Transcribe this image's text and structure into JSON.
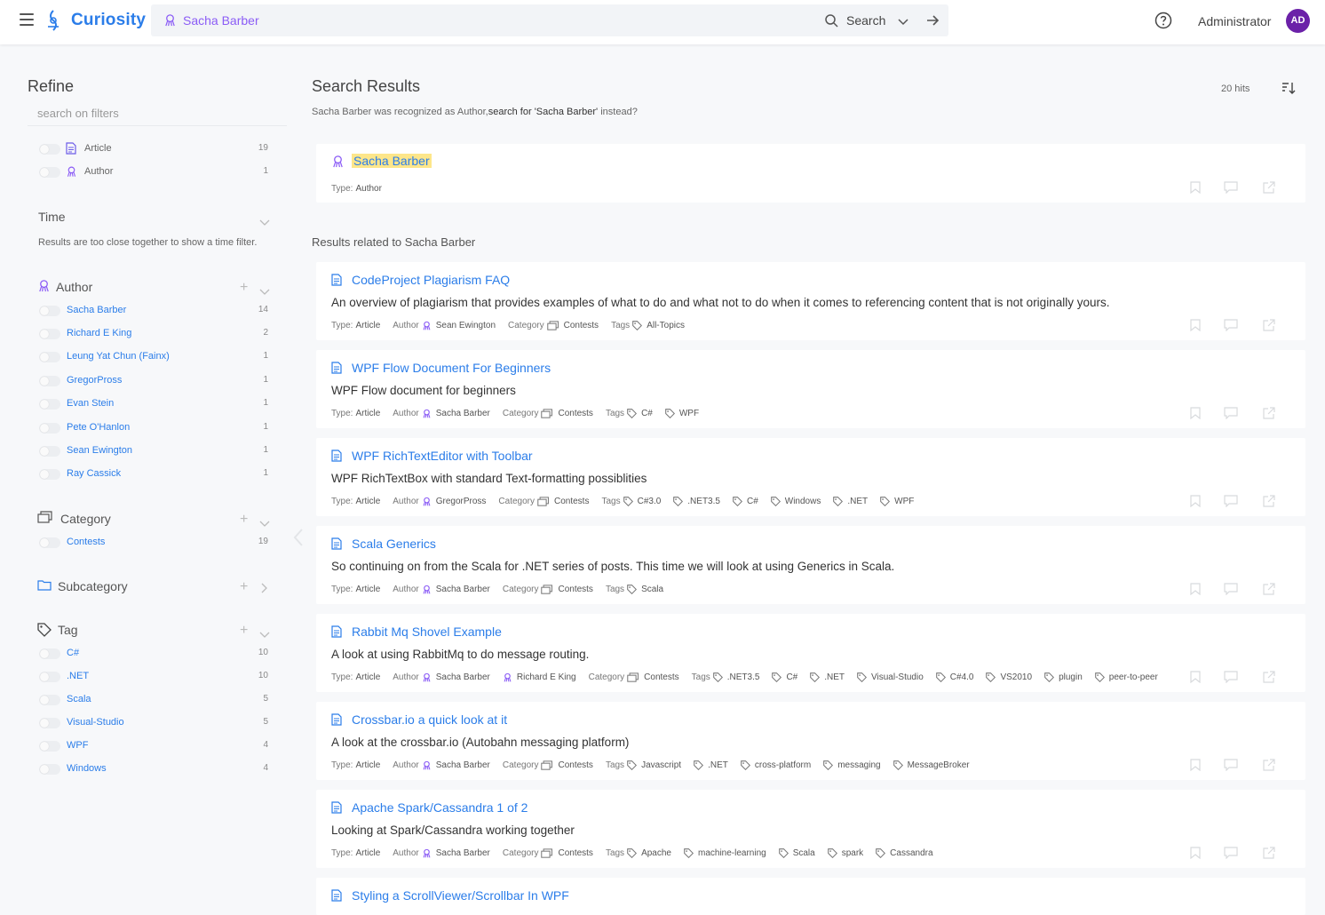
{
  "app": {
    "name": "Curiosity"
  },
  "search": {
    "query": "Sacha Barber",
    "button_label": "Search"
  },
  "user": {
    "name": "Administrator",
    "initials": "AD"
  },
  "colors": {
    "accent": "#2b7de9",
    "author": "#8b5cf6",
    "highlight": "#fde68a",
    "avatar": "#6b21a8"
  },
  "refine": {
    "title": "Refine",
    "filter_placeholder": "search on filters",
    "types": [
      {
        "label": "Article",
        "count": "19",
        "icon": "document-icon"
      },
      {
        "label": "Author",
        "count": "1",
        "icon": "author-icon"
      }
    ],
    "time": {
      "title": "Time",
      "note": "Results are too close together to show a time filter."
    },
    "author": {
      "title": "Author",
      "items": [
        {
          "label": "Sacha Barber",
          "count": "14"
        },
        {
          "label": "Richard E King",
          "count": "2"
        },
        {
          "label": "Leung Yat Chun (Fainx)",
          "count": "1"
        },
        {
          "label": "GregorPross",
          "count": "1"
        },
        {
          "label": "Evan Stein",
          "count": "1"
        },
        {
          "label": "Pete O'Hanlon",
          "count": "1"
        },
        {
          "label": "Sean Ewington",
          "count": "1"
        },
        {
          "label": "Ray Cassick",
          "count": "1"
        }
      ]
    },
    "category": {
      "title": "Category",
      "items": [
        {
          "label": "Contests",
          "count": "19"
        }
      ]
    },
    "subcategory": {
      "title": "Subcategory"
    },
    "tag": {
      "title": "Tag",
      "items": [
        {
          "label": "C#",
          "count": "10"
        },
        {
          "label": ".NET",
          "count": "10"
        },
        {
          "label": "Scala",
          "count": "5"
        },
        {
          "label": "Visual-Studio",
          "count": "5"
        },
        {
          "label": "WPF",
          "count": "4"
        },
        {
          "label": "Windows",
          "count": "4"
        }
      ]
    }
  },
  "results": {
    "title": "Search Results",
    "hits": "20 hits",
    "recognition_prefix": "Sacha Barber was recognized as Author,",
    "recognition_link": "search for 'Sacha Barber'",
    "recognition_suffix": " instead?",
    "top": {
      "title": "Sacha Barber",
      "type_label": "Type:",
      "type_value": "Author"
    },
    "related_title": "Results related to Sacha Barber",
    "labels": {
      "type": "Type:",
      "author": "Author",
      "category": "Category",
      "tags": "Tags"
    },
    "items": [
      {
        "title": "CodeProject Plagiarism FAQ",
        "desc": "An overview of plagiarism that provides examples of what to do and what not to do when it comes to referencing content that is not originally yours.",
        "type": "Article",
        "authors": [
          "Sean Ewington"
        ],
        "category": "Contests",
        "tags": [
          "All-Topics"
        ]
      },
      {
        "title": "WPF Flow Document For Beginners",
        "desc": "WPF Flow document for beginners",
        "type": "Article",
        "authors": [
          "Sacha Barber"
        ],
        "category": "Contests",
        "tags": [
          "C#",
          "WPF"
        ]
      },
      {
        "title": "WPF RichTextEditor with Toolbar",
        "desc": "WPF RichTextBox with standard Text-formatting possiblities",
        "type": "Article",
        "authors": [
          "GregorPross"
        ],
        "category": "Contests",
        "tags": [
          "C#3.0",
          ".NET3.5",
          "C#",
          "Windows",
          ".NET",
          "WPF"
        ]
      },
      {
        "title": "Scala Generics",
        "desc": "So continuing on from the Scala for .NET series of posts. This time we will look at using Generics in Scala.",
        "type": "Article",
        "authors": [
          "Sacha Barber"
        ],
        "category": "Contests",
        "tags": [
          "Scala"
        ]
      },
      {
        "title": "Rabbit Mq Shovel Example",
        "desc": "A look at using RabbitMq to do message routing.",
        "type": "Article",
        "authors": [
          "Sacha Barber",
          "Richard E King"
        ],
        "category": "Contests",
        "tags": [
          ".NET3.5",
          "C#",
          ".NET",
          "Visual-Studio",
          "C#4.0",
          "VS2010",
          "plugin",
          "peer-to-peer"
        ]
      },
      {
        "title": "Crossbar.io a quick look at it",
        "desc": "A look at the crossbar.io (Autobahn messaging platform)",
        "type": "Article",
        "authors": [
          "Sacha Barber"
        ],
        "category": "Contests",
        "tags": [
          "Javascript",
          ".NET",
          "cross-platform",
          "messaging",
          "MessageBroker"
        ]
      },
      {
        "title": "Apache Spark/Cassandra 1 of 2",
        "desc": "Looking at Spark/Cassandra working together",
        "type": "Article",
        "authors": [
          "Sacha Barber"
        ],
        "category": "Contests",
        "tags": [
          "Apache",
          "machine-learning",
          "Scala",
          "spark",
          "Cassandra"
        ]
      },
      {
        "title": "Styling a ScrollViewer/Scrollbar In WPF",
        "desc": "",
        "type": "Article",
        "authors": [],
        "category": "",
        "tags": []
      }
    ]
  }
}
